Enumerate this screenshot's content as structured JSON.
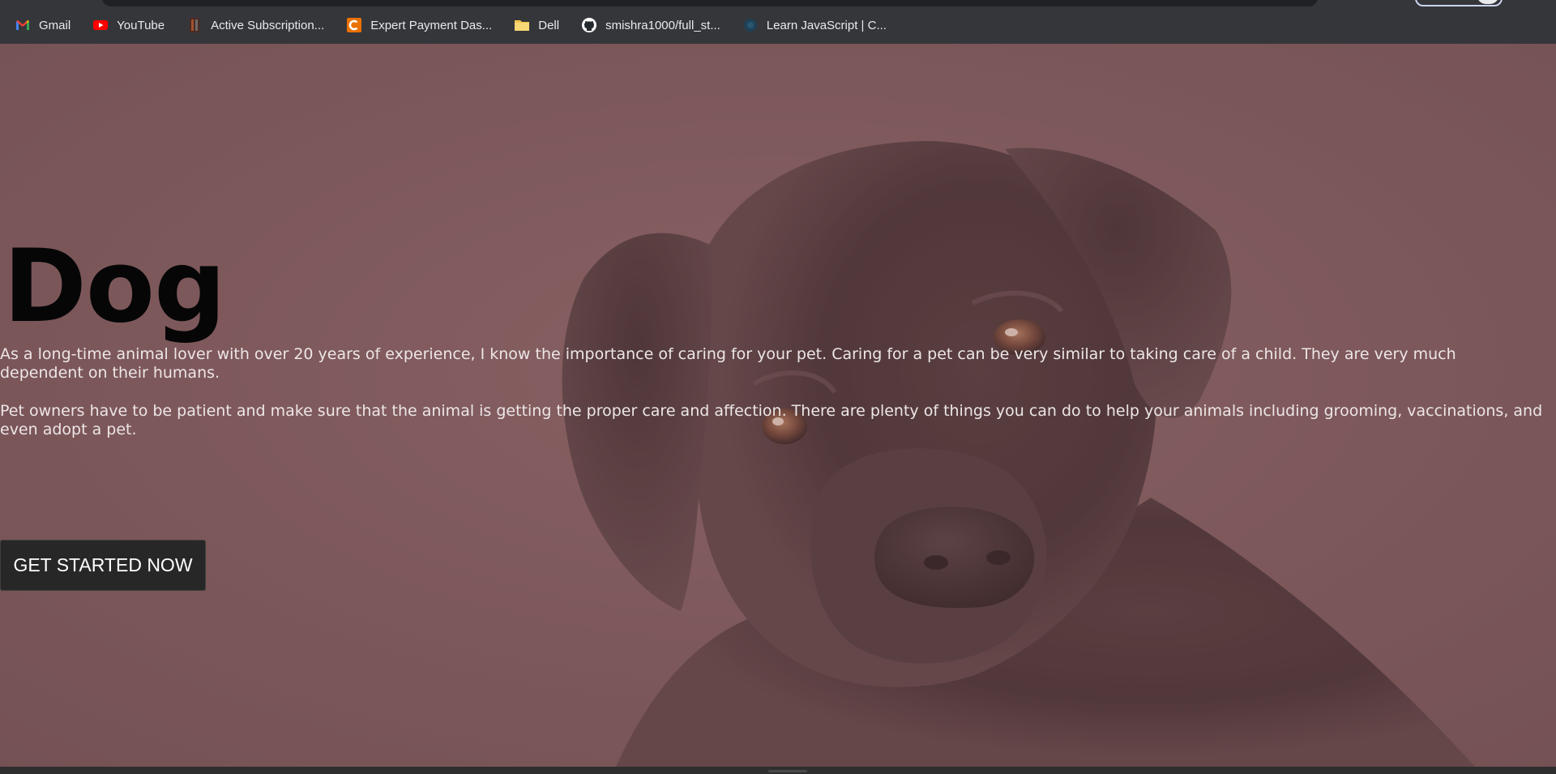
{
  "browser": {
    "bookmarks": [
      {
        "label": "Gmail",
        "icon": "gmail-icon"
      },
      {
        "label": "YouTube",
        "icon": "youtube-icon"
      },
      {
        "label": "Active Subscription...",
        "icon": "bookmark-favicon"
      },
      {
        "label": "Expert Payment Das...",
        "icon": "chegg-icon"
      },
      {
        "label": "Dell",
        "icon": "folder-icon"
      },
      {
        "label": "smishra1000/full_st...",
        "icon": "github-icon"
      },
      {
        "label": "Learn JavaScript | C...",
        "icon": "codecademy-icon"
      }
    ]
  },
  "hero": {
    "title": "Dog",
    "paragraphs": [
      "As a long-time animal lover with over 20 years of experience, I know the importance of caring for your pet. Caring for a pet can be very similar to taking care of a child. They are very much dependent on their humans.",
      "Pet owners have to be patient and make sure that the animal is getting the proper care and affection. There are plenty of things you can do to help your animals including grooming, vaccinations, and even adopt a pet."
    ],
    "cta_label": "GET STARTED NOW",
    "background_image": "dog-photo",
    "overlay_color": "#805658"
  },
  "colors": {
    "chrome": "#35363a",
    "page_bg": "#7b5a5c",
    "title": "#060606",
    "body_text": "#ede6e6",
    "button_bg": "#272727"
  }
}
